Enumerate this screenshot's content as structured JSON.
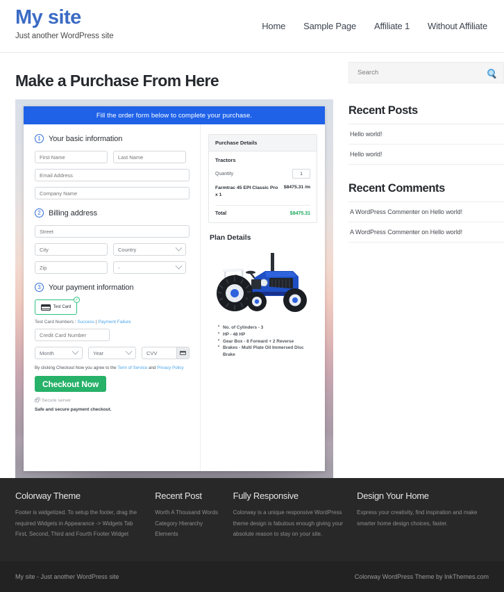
{
  "header": {
    "site_title": "My site",
    "tagline": "Just another WordPress site",
    "nav": [
      {
        "label": "Home"
      },
      {
        "label": "Sample Page"
      },
      {
        "label": "Affiliate 1"
      },
      {
        "label": "Without Affiliate"
      }
    ]
  },
  "main": {
    "page_title": "Make a Purchase From Here",
    "banner": "Fill the order form below to complete your purchase.",
    "steps": {
      "one": {
        "num": "1",
        "label": "Your basic information"
      },
      "two": {
        "num": "2",
        "label": "Billing address"
      },
      "three": {
        "num": "3",
        "label": "Your payment information"
      }
    },
    "fields": {
      "first_name": "First Name",
      "last_name": "Last Name",
      "email": "Email Address",
      "company": "Company Name",
      "street": "Street",
      "city": "City",
      "country": "Country",
      "zip": "Zip",
      "state": "-",
      "card_number": "Credit Card Number",
      "month": "Month",
      "year": "Year",
      "cvv": "CVV"
    },
    "payment": {
      "test_card_label": "Test  Card",
      "check_badge": "✓",
      "note_prefix": "Test Card Numbers : ",
      "note_success": "Success",
      "note_sep": " | ",
      "note_failure": "Payment Failure",
      "tos_prefix": "By clicking Checkout Now you agree to the ",
      "tos_terms": "Term of Service",
      "tos_and": " and ",
      "tos_privacy": "Privacy Policy",
      "checkout_label": "Checkout Now",
      "secure_server": "Secure server",
      "safe_note": "Safe and secure payment checkout."
    },
    "purchase_details": {
      "heading": "Purchase Details",
      "product": "Tractors",
      "quantity_label": "Quantity",
      "quantity_value": "1",
      "item_name": "Farmtrac 45 EPI Classic Pro x 1",
      "item_price": "$8475.31 /m",
      "total_label": "Total",
      "total_value": "$8475.31",
      "total_color": "#1ca85c"
    },
    "plan": {
      "title": "Plan Details",
      "image_name": "blue-tractor-photo",
      "specs": [
        "No. of Cylinders - 3",
        "HP - 48 HP",
        "Gear Box - 8 Forward + 2 Reverse",
        "Brakes - Multi Plate Oil Immersed Disc Brake"
      ]
    }
  },
  "sidebar": {
    "search_placeholder": "Search",
    "recent_posts": {
      "title": "Recent Posts",
      "items": [
        "Hello world!",
        "Hello world!"
      ]
    },
    "recent_comments": {
      "title": "Recent Comments",
      "items": [
        "A WordPress Commenter on Hello world!",
        "A WordPress Commenter on Hello world!"
      ]
    }
  },
  "footer": {
    "widgets": [
      {
        "title": "Colorway Theme",
        "text": "Footer is widgetized. To setup the footer, drag the required Widgets in Appearance -> Widgets Tab First, Second, Third and Fourth Footer Widget"
      },
      {
        "title": "Recent Post",
        "items": [
          "Worth A Thousand Words",
          "Category Hierarchy",
          "Elements"
        ]
      },
      {
        "title": "Fully Responsive",
        "text": "Colorway is a unique responsive WordPress theme design is fabulous enough giving your absolute reason to stay on your site."
      },
      {
        "title": "Design Your Home",
        "text": "Express your creativity, find inspiration and make smarter home design choices, faster."
      }
    ],
    "bottom_left": "My site - Just another WordPress site",
    "bottom_right": "Colorway WordPress Theme by InkThemes.com"
  },
  "colors": {
    "brand_blue": "#3b6bc4",
    "banner_blue": "#1f62e8",
    "accent_green": "#27b169",
    "footer_dark": "#282828"
  }
}
